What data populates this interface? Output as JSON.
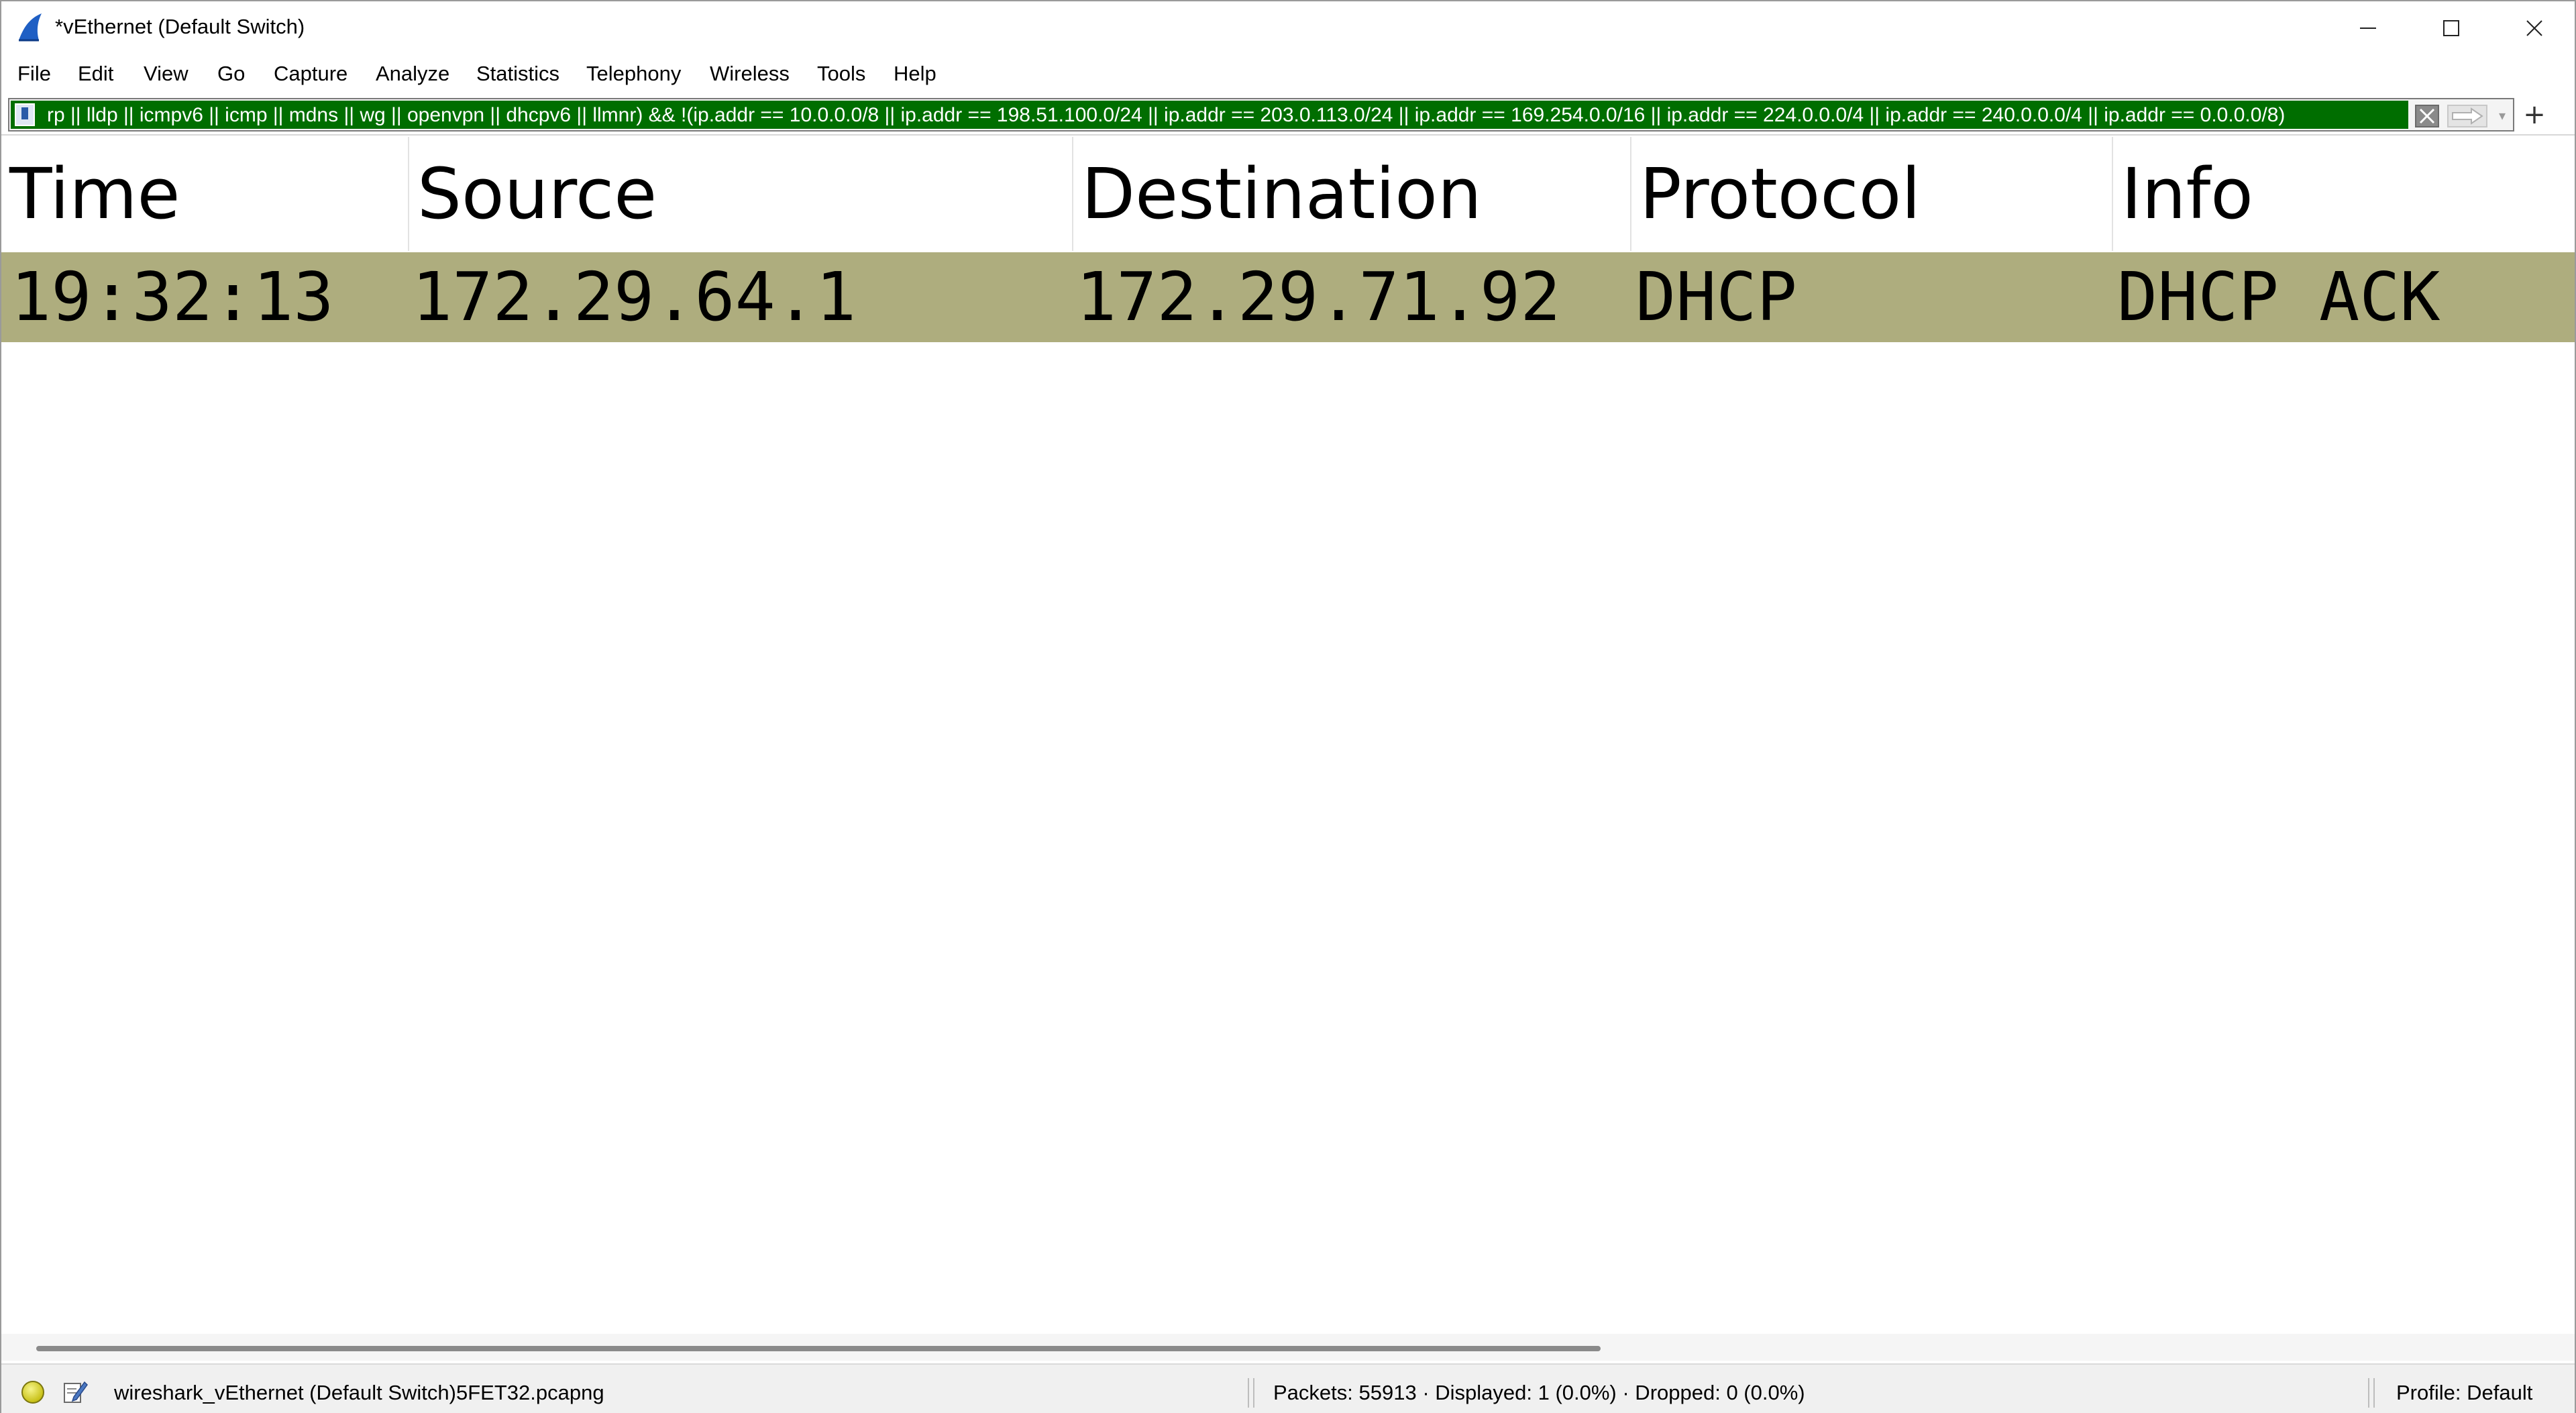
{
  "window": {
    "title": "*vEthernet (Default Switch)"
  },
  "menu": {
    "items": [
      "File",
      "Edit",
      "View",
      "Go",
      "Capture",
      "Analyze",
      "Statistics",
      "Telephony",
      "Wireless",
      "Tools",
      "Help"
    ]
  },
  "filter": {
    "value": "rp || lldp || icmpv6 || icmp || mdns || wg || openvpn || dhcpv6 || llmnr) && !(ip.addr == 10.0.0.0/8 || ip.addr == 198.51.100.0/24 || ip.addr == 203.0.113.0/24 || ip.addr == 169.254.0.0/16 || ip.addr == 224.0.0.0/4 || ip.addr == 240.0.0.0/4 || ip.addr == 0.0.0.0/8)",
    "background_color": "#006e00",
    "add_label": "+"
  },
  "packet_list": {
    "columns": [
      "Time",
      "Source",
      "Destination",
      "Protocol",
      "Info"
    ],
    "rows": [
      {
        "time": "19:32:13",
        "source": "172.29.64.1",
        "destination": "172.29.71.92",
        "protocol": "DHCP",
        "info": "DHCP ACK",
        "row_color": "#aead7e"
      }
    ]
  },
  "statusbar": {
    "file": "wireshark_vEthernet (Default Switch)5FET32.pcapng",
    "packets": "Packets: 55913 · Displayed: 1 (0.0%) · Dropped: 0 (0.0%)",
    "profile": "Profile: Default"
  },
  "icons": {
    "app": "wireshark-shark-fin-icon",
    "bookmark": "bookmark-icon",
    "clear": "clear-filter-icon",
    "apply": "apply-arrow-icon",
    "led": "capture-status-led-icon",
    "edit": "capture-comment-icon"
  }
}
